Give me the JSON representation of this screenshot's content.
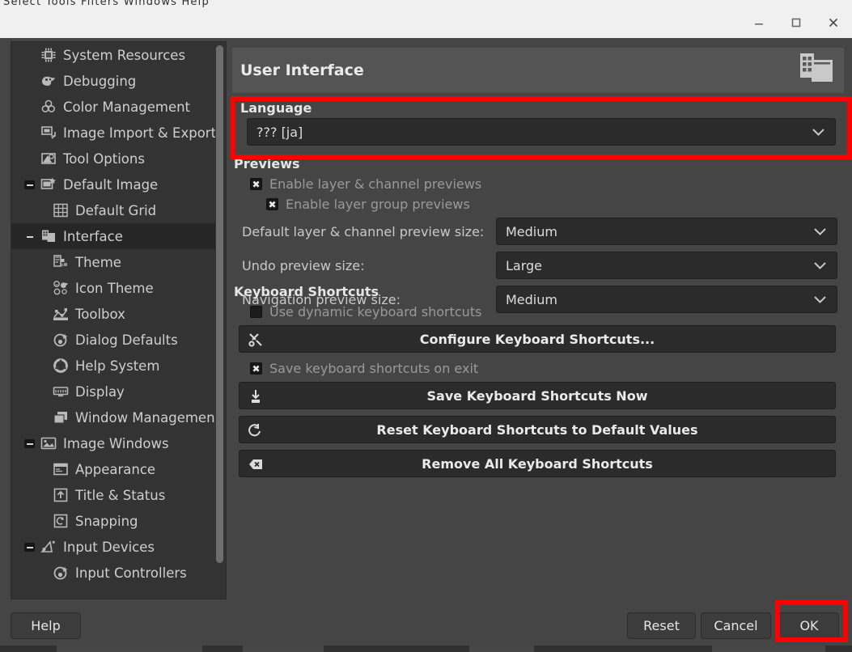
{
  "background_app": {
    "menubar_text": "Select  Tools  Filters  Windows  Help"
  },
  "window": {
    "controls": {
      "minimize_label": "minimize",
      "maximize_label": "maximize",
      "close_label": "close"
    }
  },
  "sidebar": {
    "items": [
      {
        "label": "System Resources",
        "icon": "chip-icon",
        "level": 0,
        "expander": "",
        "selected": false
      },
      {
        "label": "Debugging",
        "icon": "wilber-icon",
        "level": 0,
        "expander": "",
        "selected": false
      },
      {
        "label": "Color Management",
        "icon": "color-circles-icon",
        "level": 0,
        "expander": "",
        "selected": false
      },
      {
        "label": "Image Import & Export",
        "icon": "import-export-icon",
        "level": 0,
        "expander": "",
        "selected": false
      },
      {
        "label": "Tool Options",
        "icon": "tool-options-icon",
        "level": 0,
        "expander": "",
        "selected": false
      },
      {
        "label": "Default Image",
        "icon": "default-image-icon",
        "level": 0,
        "expander": "minus",
        "selected": false
      },
      {
        "label": "Default Grid",
        "icon": "grid-icon",
        "level": 1,
        "expander": "",
        "selected": false
      },
      {
        "label": "Interface",
        "icon": "interface-icon",
        "level": 0,
        "expander": "minus-flat",
        "selected": true
      },
      {
        "label": "Theme",
        "icon": "theme-icon",
        "level": 1,
        "expander": "",
        "selected": false
      },
      {
        "label": "Icon Theme",
        "icon": "icon-theme-icon",
        "level": 1,
        "expander": "",
        "selected": false
      },
      {
        "label": "Toolbox",
        "icon": "toolbox-icon",
        "level": 1,
        "expander": "",
        "selected": false
      },
      {
        "label": "Dialog Defaults",
        "icon": "dialog-defaults-icon",
        "level": 1,
        "expander": "",
        "selected": false
      },
      {
        "label": "Help System",
        "icon": "help-system-icon",
        "level": 1,
        "expander": "",
        "selected": false
      },
      {
        "label": "Display",
        "icon": "display-icon",
        "level": 1,
        "expander": "",
        "selected": false
      },
      {
        "label": "Window Management",
        "icon": "window-management-icon",
        "level": 1,
        "expander": "",
        "selected": false
      },
      {
        "label": "Image Windows",
        "icon": "image-windows-icon",
        "level": 0,
        "expander": "minus",
        "selected": false
      },
      {
        "label": "Appearance",
        "icon": "appearance-icon",
        "level": 1,
        "expander": "",
        "selected": false
      },
      {
        "label": "Title & Status",
        "icon": "title-status-icon",
        "level": 1,
        "expander": "",
        "selected": false
      },
      {
        "label": "Snapping",
        "icon": "snapping-icon",
        "level": 1,
        "expander": "",
        "selected": false
      },
      {
        "label": "Input Devices",
        "icon": "input-devices-icon",
        "level": 0,
        "expander": "minus",
        "selected": false
      },
      {
        "label": "Input Controllers",
        "icon": "input-controllers-icon",
        "level": 1,
        "expander": "",
        "selected": false
      }
    ]
  },
  "pane": {
    "title": "User Interface",
    "header_icon": "user-interface-icon",
    "language": {
      "section_label": "Language",
      "selected": "??? [ja]"
    },
    "previews": {
      "section_label": "Previews",
      "enable_layer_channel": {
        "label": "Enable layer & channel previews",
        "checked": true
      },
      "enable_layer_group": {
        "label": "Enable layer group previews",
        "checked": true
      },
      "fields": [
        {
          "label": "Default layer & channel preview size:",
          "value": "Medium"
        },
        {
          "label": "Undo preview size:",
          "value": "Large"
        },
        {
          "label": "Navigation preview size:",
          "value": "Medium"
        }
      ]
    },
    "shortcuts": {
      "section_label": "Keyboard Shortcuts",
      "use_dynamic": {
        "label": "Use dynamic keyboard shortcuts",
        "checked": false
      },
      "save_on_exit": {
        "label": "Save keyboard shortcuts on exit",
        "checked": true
      },
      "buttons": [
        {
          "label": "Configure Keyboard Shortcuts...",
          "icon": "wrench-screwdriver-icon"
        },
        {
          "label": "Save Keyboard Shortcuts Now",
          "icon": "save-icon"
        },
        {
          "label": "Reset Keyboard Shortcuts to Default Values",
          "icon": "revert-icon"
        },
        {
          "label": "Remove All Keyboard Shortcuts",
          "icon": "delete-icon"
        }
      ]
    }
  },
  "footer": {
    "help": "Help",
    "reset": "Reset",
    "cancel": "Cancel",
    "ok": "OK"
  },
  "annotations": {
    "highlight_color": "#ff0000",
    "boxes": [
      {
        "target": "language-section"
      },
      {
        "target": "ok-button"
      }
    ]
  }
}
